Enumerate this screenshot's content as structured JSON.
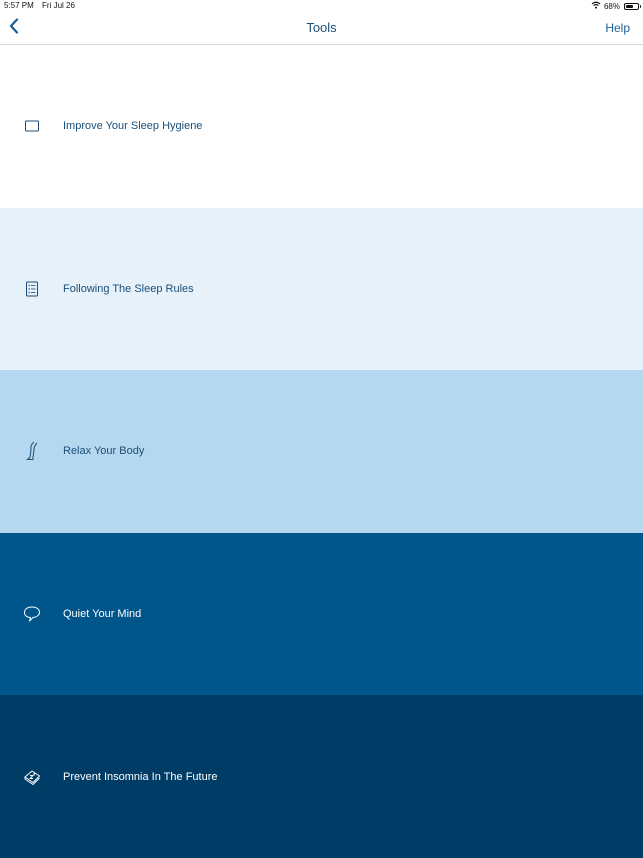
{
  "status_bar": {
    "time": "5:57 PM",
    "date": "Fri Jul 26",
    "battery_percent": "68%",
    "battery_level": 0.68,
    "icons": [
      "wifi-icon",
      "battery-icon"
    ]
  },
  "nav": {
    "back_icon": "chevron-left-icon",
    "title": "Tools",
    "help_label": "Help"
  },
  "tools": [
    {
      "label": "Improve Your Sleep Hygiene",
      "icon": "rectangle-outline-icon",
      "background": "#ffffff",
      "text_color": "#1b4f79"
    },
    {
      "label": "Following The Sleep Rules",
      "icon": "checklist-icon",
      "background": "#e6f1f9",
      "text_color": "#1b4f79"
    },
    {
      "label": "Relax Your Body",
      "icon": "leg-icon",
      "background": "#b5d7ef",
      "text_color": "#1b4f79"
    },
    {
      "label": "Quiet Your Mind",
      "icon": "thought-bubble-icon",
      "background": "#00558b",
      "text_color": "#ffffff"
    },
    {
      "label": "Prevent Insomnia In The Future",
      "icon": "book-zzz-icon",
      "background": "#003d66",
      "text_color": "#ffffff"
    }
  ]
}
